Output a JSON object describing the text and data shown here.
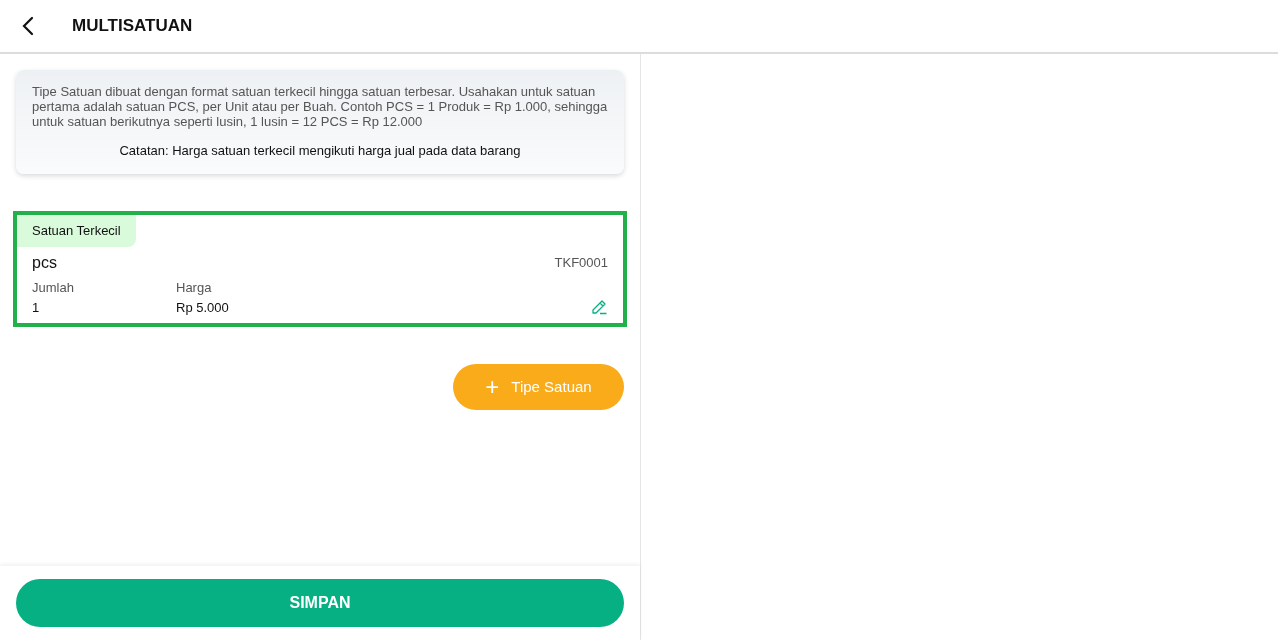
{
  "header": {
    "title": "MULTISATUAN"
  },
  "info": {
    "text": "Tipe Satuan dibuat dengan format satuan terkecil hingga satuan terbesar. Usahakan untuk satuan pertama adalah satuan PCS, per Unit atau per Buah. Contoh PCS = 1 Produk = Rp 1.000, sehingga untuk satuan berikutnya seperti lusin, 1 lusin = 12 PCS = Rp 12.000",
    "note": "Catatan: Harga satuan terkecil mengikuti harga jual pada data barang"
  },
  "units": [
    {
      "tag": "Satuan Terkecil",
      "name": "pcs",
      "code": "TKF0001",
      "qty_label": "Jumlah",
      "qty": "1",
      "price_label": "Harga",
      "price": "Rp 5.000",
      "selected": true
    }
  ],
  "add_button": {
    "icon": "+",
    "label": "Tipe Satuan"
  },
  "save_button": {
    "label": "SIMPAN"
  }
}
